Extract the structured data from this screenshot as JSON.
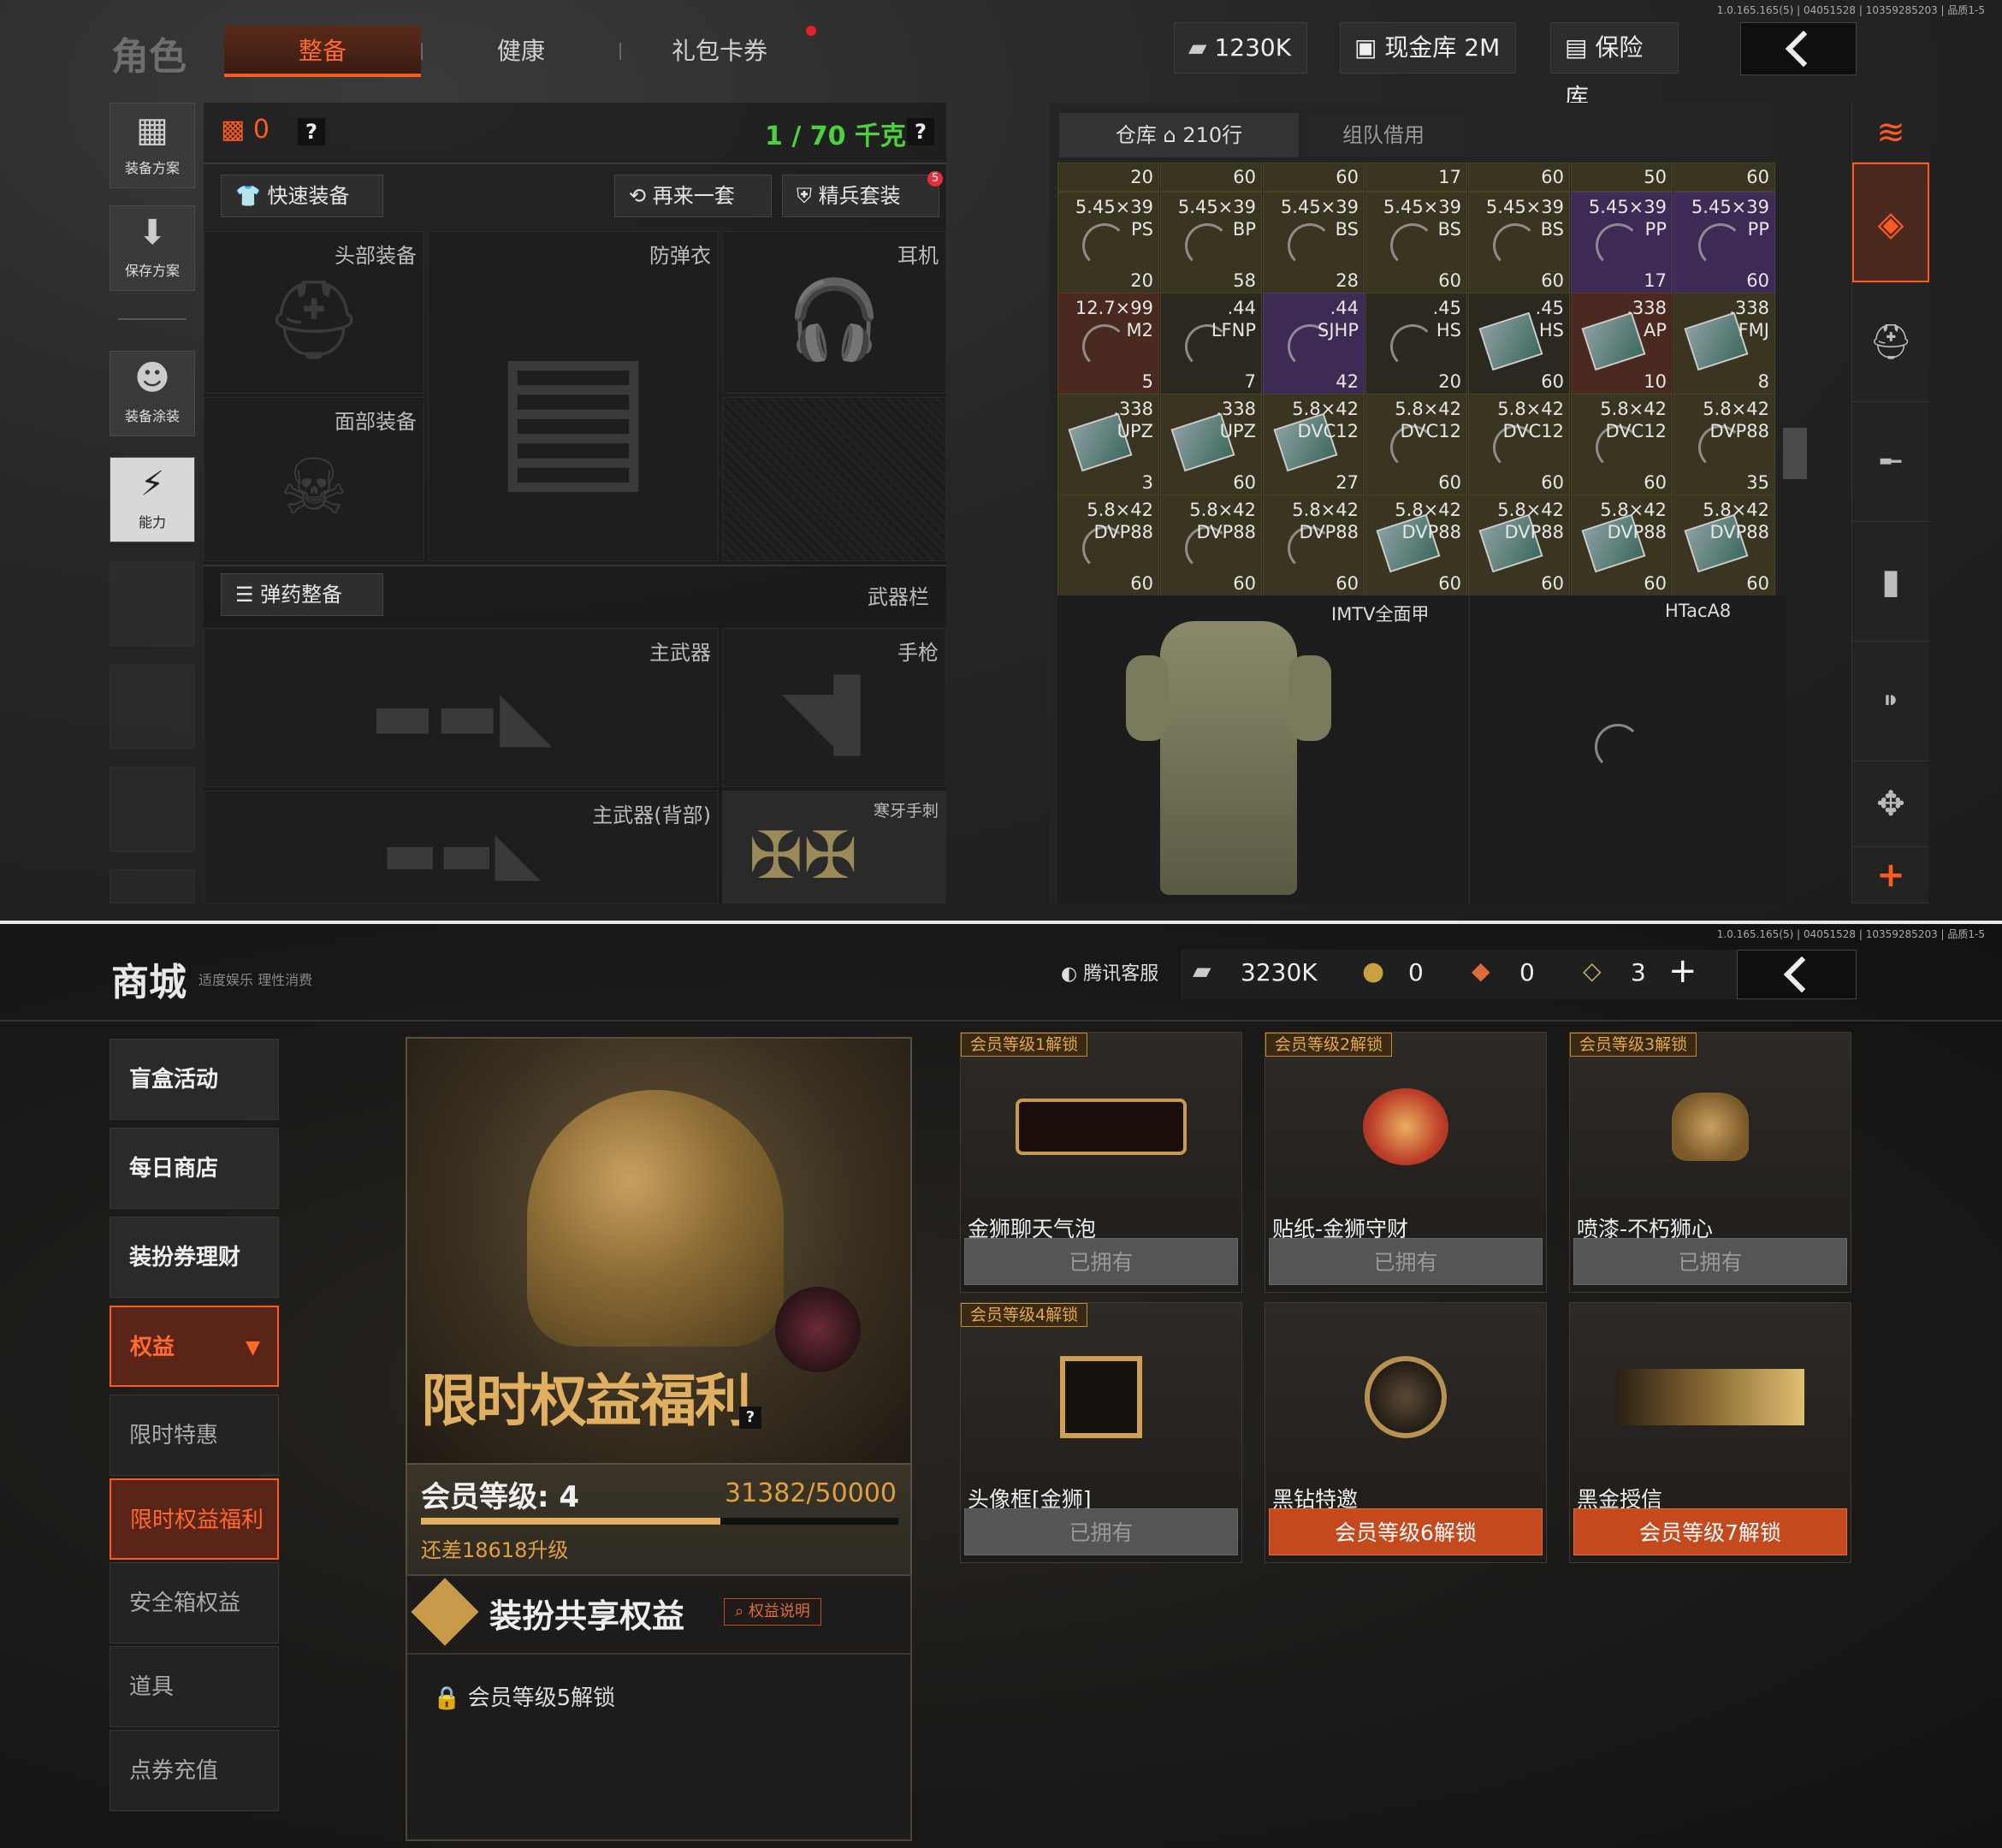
{
  "top": {
    "version": "1.0.165.165(5) | 04051528 | 10359285203 | 品质1-5",
    "title": "角色",
    "tabs": [
      "整备",
      "健康",
      "礼包卡券"
    ],
    "currency": "1230K",
    "cash_vault": "现金库 2M",
    "insurance": "保险库",
    "left_buttons": [
      "装备方案",
      "保存方案",
      "装备涂装",
      "能力"
    ],
    "armor_count": "0",
    "weight": "1 / 70 千克",
    "quick_equip": "快速装备",
    "again": "再来一套",
    "elite_set": "精兵套装",
    "elite_badge": "5",
    "slots": {
      "head": "头部装备",
      "vest": "防弹衣",
      "ear": "耳机",
      "face": "面部装备",
      "ammo_prep": "弹药整备",
      "weapon_bar": "武器栏",
      "primary": "主武器",
      "pistol": "手枪",
      "primary_back": "主武器(背部)",
      "melee": "寒牙手刺"
    },
    "inventory": {
      "tab_warehouse": "仓库",
      "rows": "210行",
      "tab_team": "组队借用",
      "partial_counts": [
        "20",
        "60",
        "60",
        "17",
        "60",
        "50",
        "60"
      ],
      "grid": [
        [
          {
            "cal": "5.45×39",
            "type": "PS",
            "n": "20",
            "col": "gold"
          },
          {
            "cal": "5.45×39",
            "type": "BP",
            "n": "58",
            "col": "gold"
          },
          {
            "cal": "5.45×39",
            "type": "BS",
            "n": "28",
            "col": "gold"
          },
          {
            "cal": "5.45×39",
            "type": "BS",
            "n": "60",
            "col": "gold"
          },
          {
            "cal": "5.45×39",
            "type": "BS",
            "n": "60",
            "col": "gold"
          },
          {
            "cal": "5.45×39",
            "type": "PP",
            "n": "17",
            "col": "purple"
          },
          {
            "cal": "5.45×39",
            "type": "PP",
            "n": "60",
            "col": "purple"
          }
        ],
        [
          {
            "cal": "12.7×99",
            "type": "M2",
            "n": "5",
            "col": "red"
          },
          {
            "cal": ".44",
            "type": "LFNP",
            "n": "7",
            "col": "dark"
          },
          {
            "cal": ".44",
            "type": "SJHP",
            "n": "42",
            "col": "purple"
          },
          {
            "cal": ".45",
            "type": "HS",
            "n": "20",
            "col": "dark"
          },
          {
            "cal": ".45",
            "type": "HS",
            "n": "60",
            "col": "dark",
            "box": true
          },
          {
            "cal": ".338",
            "type": "AP",
            "n": "10",
            "col": "red",
            "box": true
          },
          {
            "cal": ".338",
            "type": "FMJ",
            "n": "8",
            "col": "gold",
            "box": true
          }
        ],
        [
          {
            "cal": ".338",
            "type": "UPZ",
            "n": "3",
            "col": "gold",
            "box": true
          },
          {
            "cal": ".338",
            "type": "UPZ",
            "n": "60",
            "col": "gold",
            "box": true
          },
          {
            "cal": "5.8×42",
            "type": "DVC12",
            "n": "27",
            "col": "gold",
            "box": true
          },
          {
            "cal": "5.8×42",
            "type": "DVC12",
            "n": "60",
            "col": "gold"
          },
          {
            "cal": "5.8×42",
            "type": "DVC12",
            "n": "60",
            "col": "gold"
          },
          {
            "cal": "5.8×42",
            "type": "DVC12",
            "n": "60",
            "col": "gold"
          },
          {
            "cal": "5.8×42",
            "type": "DVP88",
            "n": "35",
            "col": "gold"
          }
        ],
        [
          {
            "cal": "5.8×42",
            "type": "DVP88",
            "n": "60",
            "col": "gold"
          },
          {
            "cal": "5.8×42",
            "type": "DVP88",
            "n": "60",
            "col": "gold"
          },
          {
            "cal": "5.8×42",
            "type": "DVP88",
            "n": "60",
            "col": "gold"
          },
          {
            "cal": "5.8×42",
            "type": "DVP88",
            "n": "60",
            "col": "gold",
            "box": true
          },
          {
            "cal": "5.8×42",
            "type": "DVP88",
            "n": "60",
            "col": "gold",
            "box": true
          },
          {
            "cal": "5.8×42",
            "type": "DVP88",
            "n": "60",
            "col": "gold",
            "box": true
          },
          {
            "cal": "5.8×42",
            "type": "DVP88",
            "n": "60",
            "col": "gold",
            "box": true
          }
        ]
      ],
      "armor1": "IMTV全面甲",
      "armor2": "HTacA8"
    }
  },
  "bottom": {
    "version": "1.0.165.165(5) | 04051528 | 10359285203 | 品质1-5",
    "title": "商城",
    "subtitle": "适度娱乐 理性消费",
    "service": "腾讯客服",
    "currency": "3230K",
    "coins": "0",
    "tickets": "0",
    "vouchers": "3",
    "nav": [
      "盲盒活动",
      "每日商店",
      "装扮券理财",
      "权益",
      "限时特惠",
      "限时权益福利",
      "安全箱权益",
      "道具",
      "点券充值"
    ],
    "banner_title": "限时权益福利",
    "member_level_label": "会员等级: 4",
    "member_progress": "31382/50000",
    "progress_fraction": 0.6276,
    "upgrade_hint": "还差18618升级",
    "share_title": "装扮共享权益",
    "share_explain": "权益说明",
    "lock_hint": "会员等级5解锁",
    "cards": [
      {
        "tag": "会员等级1解锁",
        "name": "金狮聊天气泡",
        "status": "已拥有",
        "hot": false
      },
      {
        "tag": "会员等级2解锁",
        "name": "贴纸-金狮守财",
        "status": "已拥有",
        "hot": false
      },
      {
        "tag": "会员等级3解锁",
        "name": "喷漆-不朽狮心",
        "status": "已拥有",
        "hot": false
      },
      {
        "tag": "会员等级4解锁",
        "name": "头像框[金狮]",
        "status": "已拥有",
        "hot": false
      },
      {
        "tag": "",
        "name": "黑钻特邀",
        "status": "会员等级6解锁",
        "hot": true
      },
      {
        "tag": "",
        "name": "黑金授信",
        "status": "会员等级7解锁",
        "hot": true
      }
    ]
  }
}
